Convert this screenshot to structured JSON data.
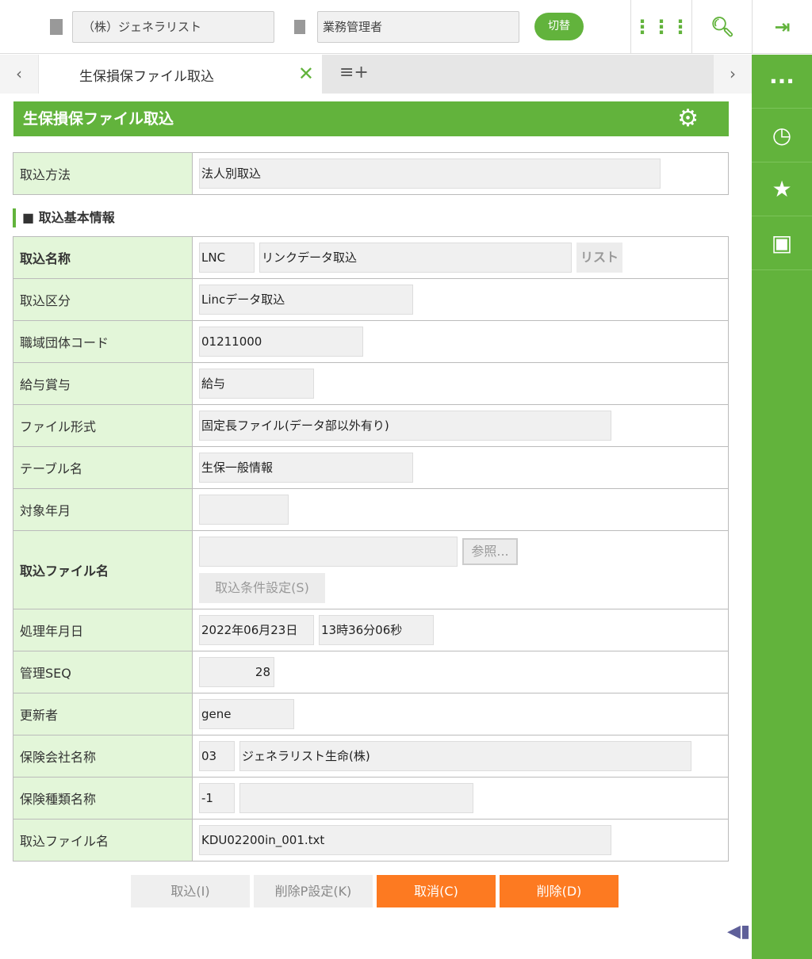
{
  "header": {
    "company": "（株）ジェネラリスト",
    "role": "業務管理者",
    "switch_label": "切替"
  },
  "tabs": {
    "active_label": "生保損保ファイル取込",
    "prev": "‹",
    "next": "›"
  },
  "page": {
    "title": "生保損保ファイル取込",
    "section_title": "■ 取込基本情報"
  },
  "method": {
    "label": "取込方法",
    "value": "法人別取込"
  },
  "form": {
    "name": {
      "label": "取込名称",
      "code": "LNC",
      "value": "リンクデータ取込",
      "list_button": "リスト"
    },
    "kubun": {
      "label": "取込区分",
      "value": "Lincデータ取込"
    },
    "org_code": {
      "label": "職域団体コード",
      "value": "01211000"
    },
    "pay": {
      "label": "給与賞与",
      "value": "給与"
    },
    "file_format": {
      "label": "ファイル形式",
      "value": "固定長ファイル(データ部以外有り)"
    },
    "table_name": {
      "label": "テーブル名",
      "value": "生保一般情報"
    },
    "target_ym": {
      "label": "対象年月",
      "value": ""
    },
    "import_file": {
      "label": "取込ファイル名",
      "value": "",
      "browse": "参照...",
      "condition_button": "取込条件設定(S)"
    },
    "process_date": {
      "label": "処理年月日",
      "date": "2022年06月23日",
      "time": "13時36分06秒"
    },
    "seq": {
      "label": "管理SEQ",
      "value": "28"
    },
    "updater": {
      "label": "更新者",
      "value": "gene"
    },
    "insurer": {
      "label": "保険会社名称",
      "code": "03",
      "value": "ジェネラリスト生命(株)"
    },
    "ins_type": {
      "label": "保険種類名称",
      "code": "-1",
      "value": ""
    },
    "file_name": {
      "label": "取込ファイル名",
      "value": "KDU02200in_001.txt"
    }
  },
  "actions": {
    "import": "取込(I)",
    "delete_p": "削除P設定(K)",
    "cancel": "取消(C)",
    "delete": "削除(D)"
  }
}
